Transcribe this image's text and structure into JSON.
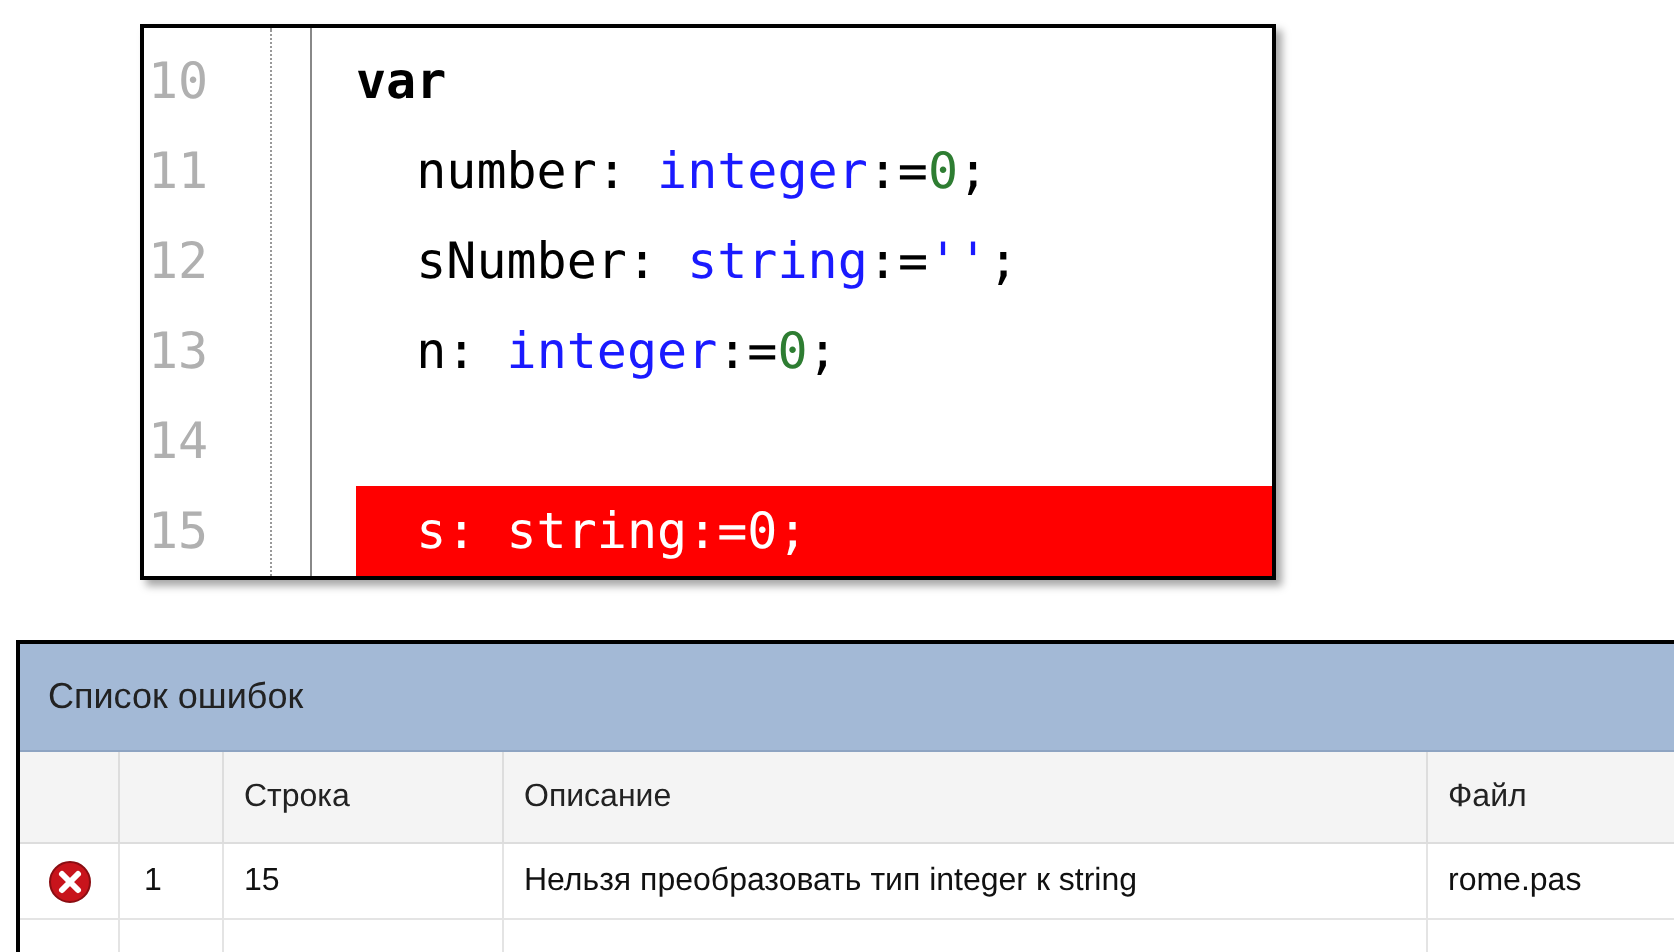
{
  "code_editor": {
    "lines": [
      {
        "number": "10",
        "highlighted": false,
        "tokens": [
          {
            "text": "var",
            "kind": "keyword"
          }
        ]
      },
      {
        "number": "11",
        "highlighted": false,
        "tokens": [
          {
            "text": "  number: ",
            "kind": "plain"
          },
          {
            "text": "integer",
            "kind": "type"
          },
          {
            "text": ":=",
            "kind": "plain"
          },
          {
            "text": "0",
            "kind": "number"
          },
          {
            "text": ";",
            "kind": "plain"
          }
        ]
      },
      {
        "number": "12",
        "highlighted": false,
        "tokens": [
          {
            "text": "  sNumber: ",
            "kind": "plain"
          },
          {
            "text": "string",
            "kind": "type"
          },
          {
            "text": ":=",
            "kind": "plain"
          },
          {
            "text": "''",
            "kind": "string"
          },
          {
            "text": ";",
            "kind": "plain"
          }
        ]
      },
      {
        "number": "13",
        "highlighted": false,
        "tokens": [
          {
            "text": "  n: ",
            "kind": "plain"
          },
          {
            "text": "integer",
            "kind": "type"
          },
          {
            "text": ":=",
            "kind": "plain"
          },
          {
            "text": "0",
            "kind": "number"
          },
          {
            "text": ";",
            "kind": "plain"
          }
        ]
      },
      {
        "number": "14"
      },
      {
        "number": "15",
        "highlighted": true,
        "tokens": [
          {
            "text": "  s: string:=0;",
            "kind": "plain"
          }
        ]
      }
    ]
  },
  "error_list": {
    "title": "Список ошибок",
    "columns": [
      "Строка",
      "Описание",
      "Файл"
    ],
    "rows": [
      {
        "kind": "error",
        "index": "1",
        "line": "15",
        "description": "Нельзя преобразовать тип integer к string",
        "file": "rome.pas"
      }
    ]
  }
}
